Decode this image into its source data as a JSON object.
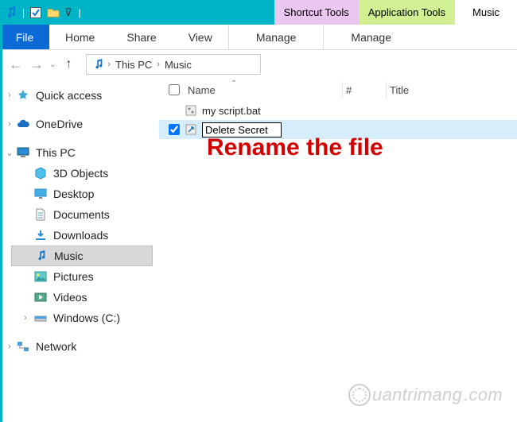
{
  "titlebar": {
    "context_tabs": {
      "shortcut": "Shortcut Tools",
      "application": "Application Tools",
      "music": "Music"
    }
  },
  "ribbon": {
    "file": "File",
    "home": "Home",
    "share": "Share",
    "view": "View",
    "manage1": "Manage",
    "manage2": "Manage"
  },
  "breadcrumbs": {
    "root": "This PC",
    "leaf": "Music"
  },
  "tree": {
    "quick_access": "Quick access",
    "onedrive": "OneDrive",
    "this_pc": "This PC",
    "objects3d": "3D Objects",
    "desktop": "Desktop",
    "documents": "Documents",
    "downloads": "Downloads",
    "music": "Music",
    "pictures": "Pictures",
    "videos": "Videos",
    "cdrive": "Windows (C:)",
    "network": "Network"
  },
  "columns": {
    "name": "Name",
    "num": "#",
    "title": "Title"
  },
  "files": [
    {
      "name": "my script.bat",
      "checked": false,
      "editing": false
    },
    {
      "name": "Delete Secret",
      "checked": true,
      "editing": true
    }
  ],
  "annotation": "Rename the file",
  "watermark": "uantrimang"
}
